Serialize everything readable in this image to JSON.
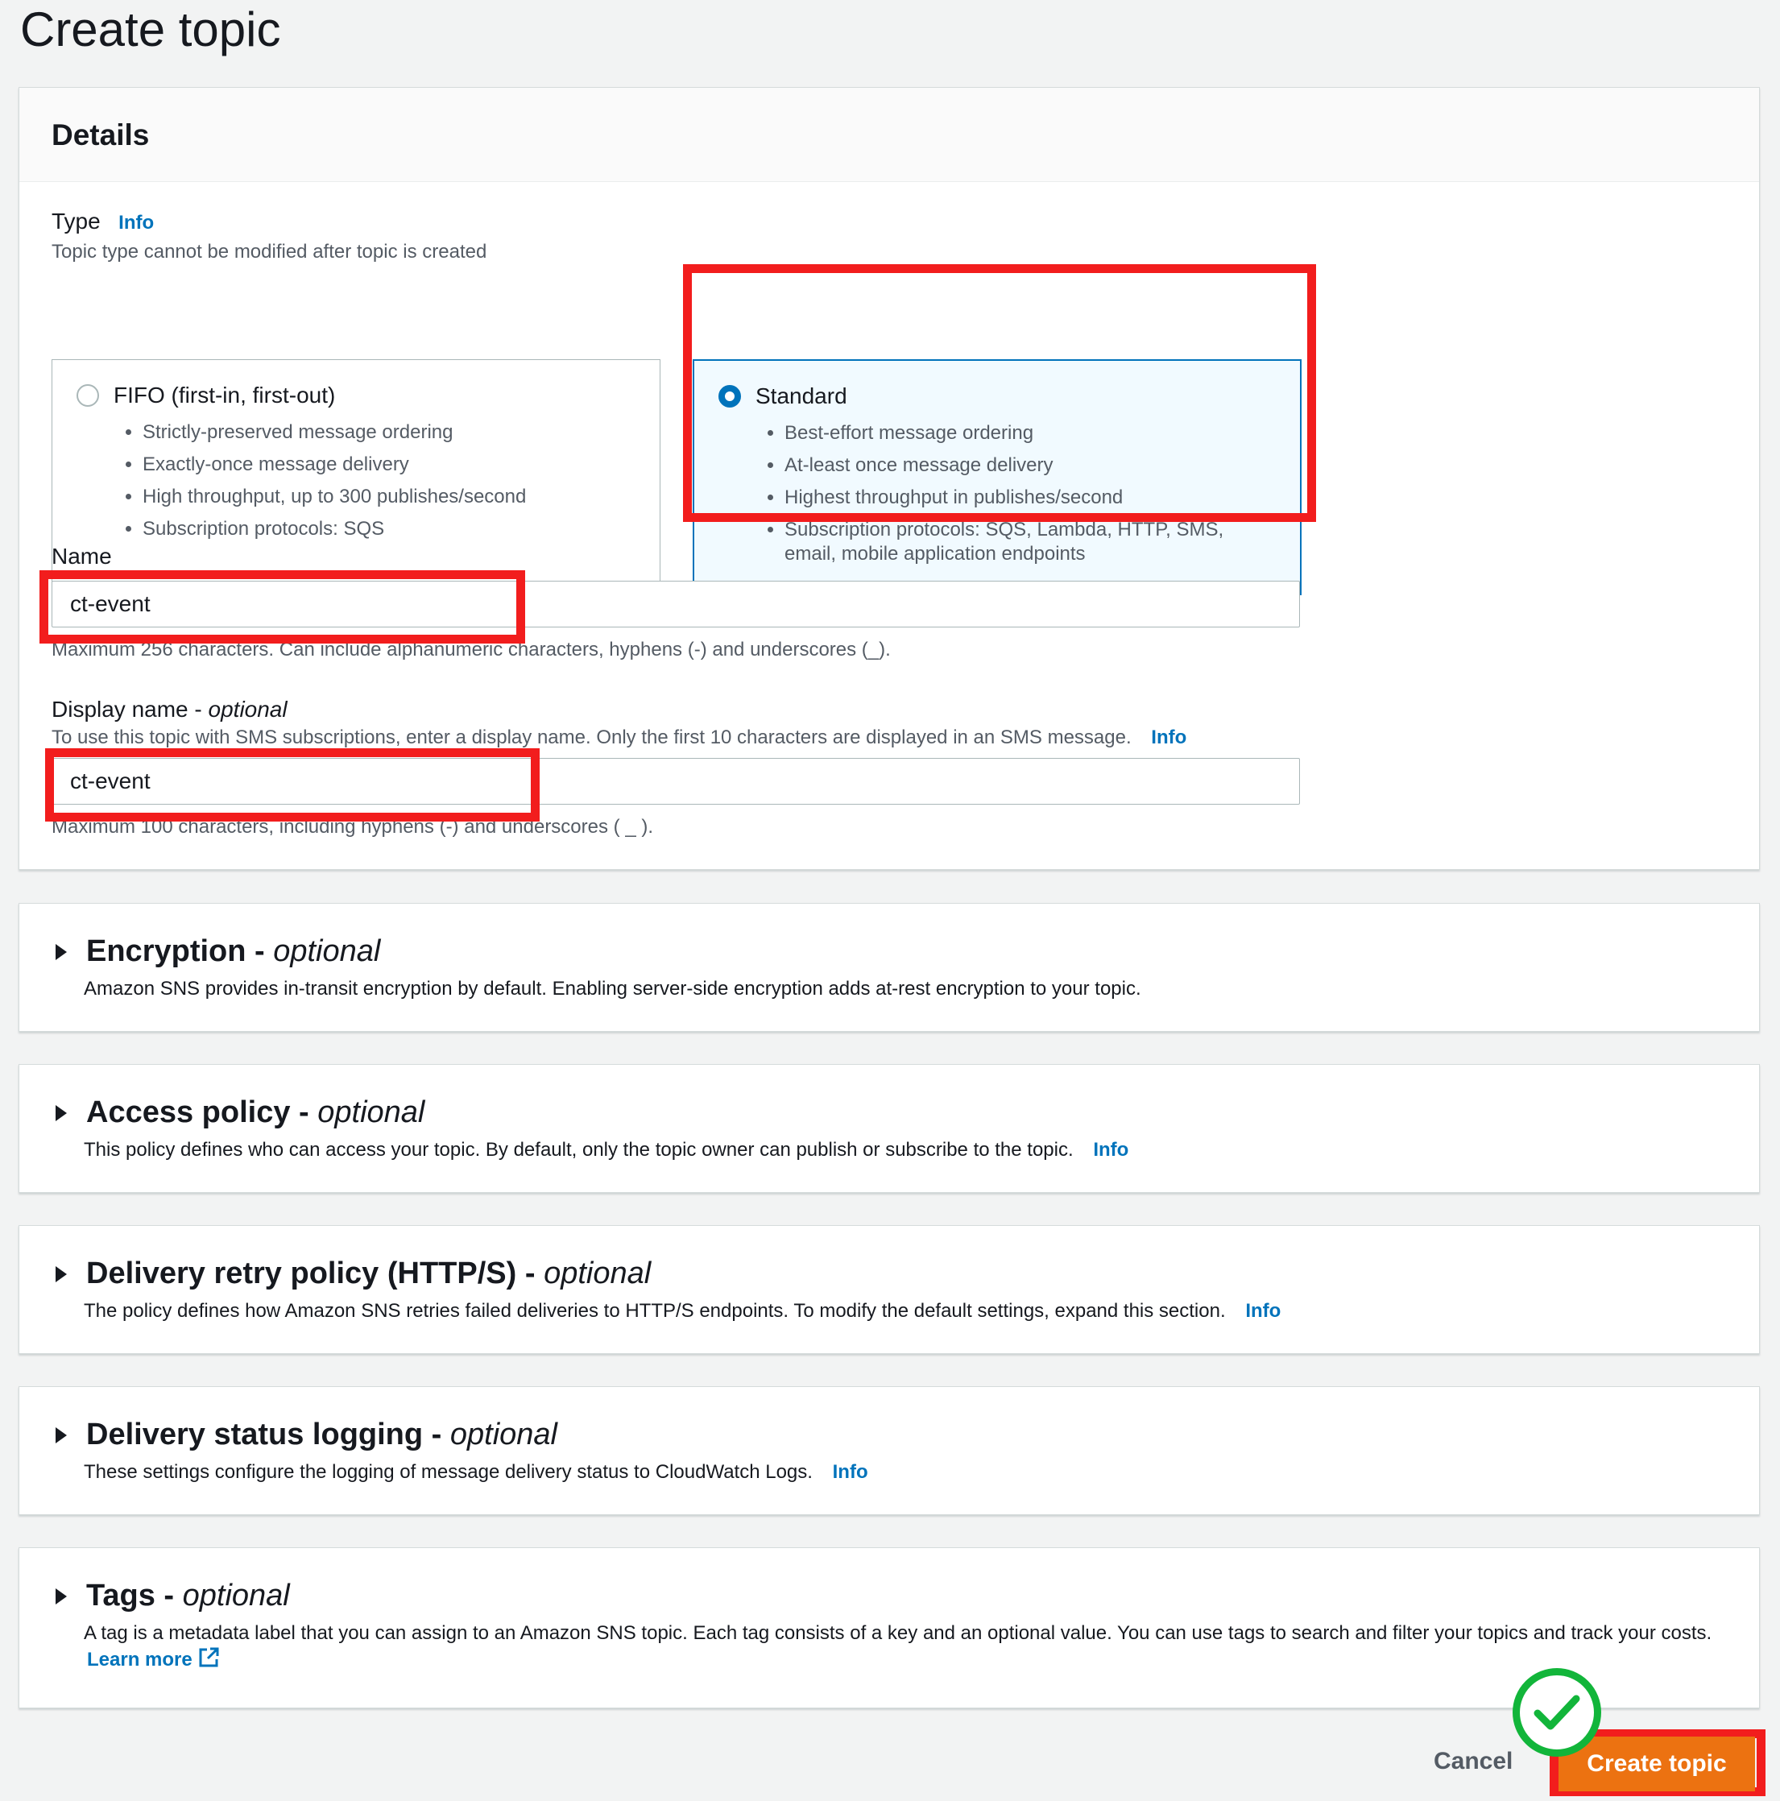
{
  "page": {
    "title": "Create topic"
  },
  "details": {
    "header": "Details",
    "type": {
      "label": "Type",
      "info": "Info",
      "description": "Topic type cannot be modified after topic is created",
      "options": [
        {
          "label": "FIFO (first-in, first-out)",
          "selected": false,
          "bullets": [
            "Strictly-preserved message ordering",
            "Exactly-once message delivery",
            "High throughput, up to 300 publishes/second",
            "Subscription protocols: SQS"
          ]
        },
        {
          "label": "Standard",
          "selected": true,
          "bullets": [
            "Best-effort message ordering",
            "At-least once message delivery",
            "Highest throughput in publishes/second",
            "Subscription protocols: SQS, Lambda, HTTP, SMS, email, mobile application endpoints"
          ]
        }
      ]
    },
    "name": {
      "label": "Name",
      "value": "ct-event",
      "hint": "Maximum 256 characters. Can include alphanumeric characters, hyphens (-) and underscores (_)."
    },
    "display_name": {
      "label": "Display name - ",
      "label_optional": "optional",
      "description": "To use this topic with SMS subscriptions, enter a display name. Only the first 10 characters are displayed in an SMS message.",
      "info": "Info",
      "value": "ct-event",
      "hint": "Maximum 100 characters, including hyphens (-) and underscores ( _ )."
    }
  },
  "sections": [
    {
      "title": "Encryption - ",
      "optional": "optional",
      "description": "Amazon SNS provides in-transit encryption by default. Enabling server-side encryption adds at-rest encryption to your topic.",
      "info": ""
    },
    {
      "title": "Access policy - ",
      "optional": "optional",
      "description": "This policy defines who can access your topic. By default, only the topic owner can publish or subscribe to the topic.",
      "info": "Info"
    },
    {
      "title": "Delivery retry policy (HTTP/S) - ",
      "optional": "optional",
      "description": "The policy defines how Amazon SNS retries failed deliveries to HTTP/S endpoints. To modify the default settings, expand this section.",
      "info": "Info"
    },
    {
      "title": "Delivery status logging - ",
      "optional": "optional",
      "description": "These settings configure the logging of message delivery status to CloudWatch Logs.",
      "info": "Info"
    },
    {
      "title": "Tags - ",
      "optional": "optional",
      "description": "A tag is a metadata label that you can assign to an Amazon SNS topic. Each tag consists of a key and an optional value. You can use tags to search and filter your topics and track your costs.",
      "info": "Learn more"
    }
  ],
  "footer": {
    "cancel": "Cancel",
    "create": "Create topic"
  },
  "colors": {
    "accent": "#0073bb",
    "primary_button": "#ec7211",
    "highlight": "#f21d1d",
    "check": "#12b53a"
  },
  "icons": [
    "radio-button-icon",
    "caret-right-icon",
    "external-link-icon",
    "checkmark-icon"
  ]
}
